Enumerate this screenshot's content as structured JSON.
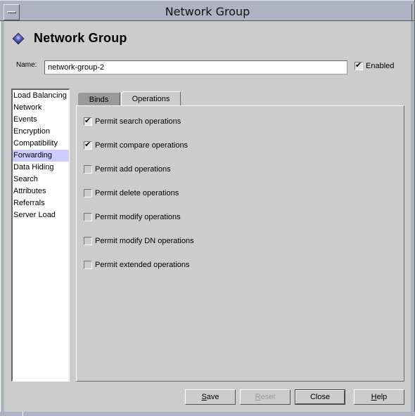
{
  "window": {
    "title": "Network Group"
  },
  "header": {
    "icon": "diamond-icon",
    "title": "Network Group"
  },
  "name_field": {
    "label": "Name:",
    "value": "network-group-2"
  },
  "enabled": {
    "label": "Enabled",
    "checked": true
  },
  "sidebar": {
    "items": [
      {
        "label": "Load Balancing",
        "selected": false
      },
      {
        "label": "Network",
        "selected": false
      },
      {
        "label": "Events",
        "selected": false
      },
      {
        "label": "Encryption",
        "selected": false
      },
      {
        "label": "Compatibility",
        "selected": false
      },
      {
        "label": "Forwarding",
        "selected": true
      },
      {
        "label": "Data Hiding",
        "selected": false
      },
      {
        "label": "Search",
        "selected": false
      },
      {
        "label": "Attributes",
        "selected": false
      },
      {
        "label": "Referrals",
        "selected": false
      },
      {
        "label": "Server Load",
        "selected": false
      }
    ]
  },
  "tabs": [
    {
      "label": "Binds",
      "active": false
    },
    {
      "label": "Operations",
      "active": true
    }
  ],
  "operations": [
    {
      "label": "Permit search operations",
      "checked": true
    },
    {
      "label": "Permit compare operations",
      "checked": true
    },
    {
      "label": "Permit add operations",
      "checked": false
    },
    {
      "label": "Permit delete operations",
      "checked": false
    },
    {
      "label": "Permit modify operations",
      "checked": false
    },
    {
      "label": "Permit modify DN operations",
      "checked": false
    },
    {
      "label": "Permit extended operations",
      "checked": false
    }
  ],
  "buttons": {
    "save": {
      "label": "Save",
      "mnemonic": "S",
      "rest": "ave",
      "enabled": true
    },
    "reset": {
      "label": "Reset",
      "mnemonic": "R",
      "rest": "eset",
      "enabled": false
    },
    "close": {
      "label": "Close",
      "enabled": true,
      "default": true
    },
    "help": {
      "label": "Help",
      "mnemonic": "H",
      "rest": "elp",
      "enabled": true
    }
  },
  "colors": {
    "window_frame": "#aeb2c3",
    "background": "#cccccc",
    "selection": "#ccccff",
    "inactive_tab": "#999999"
  }
}
